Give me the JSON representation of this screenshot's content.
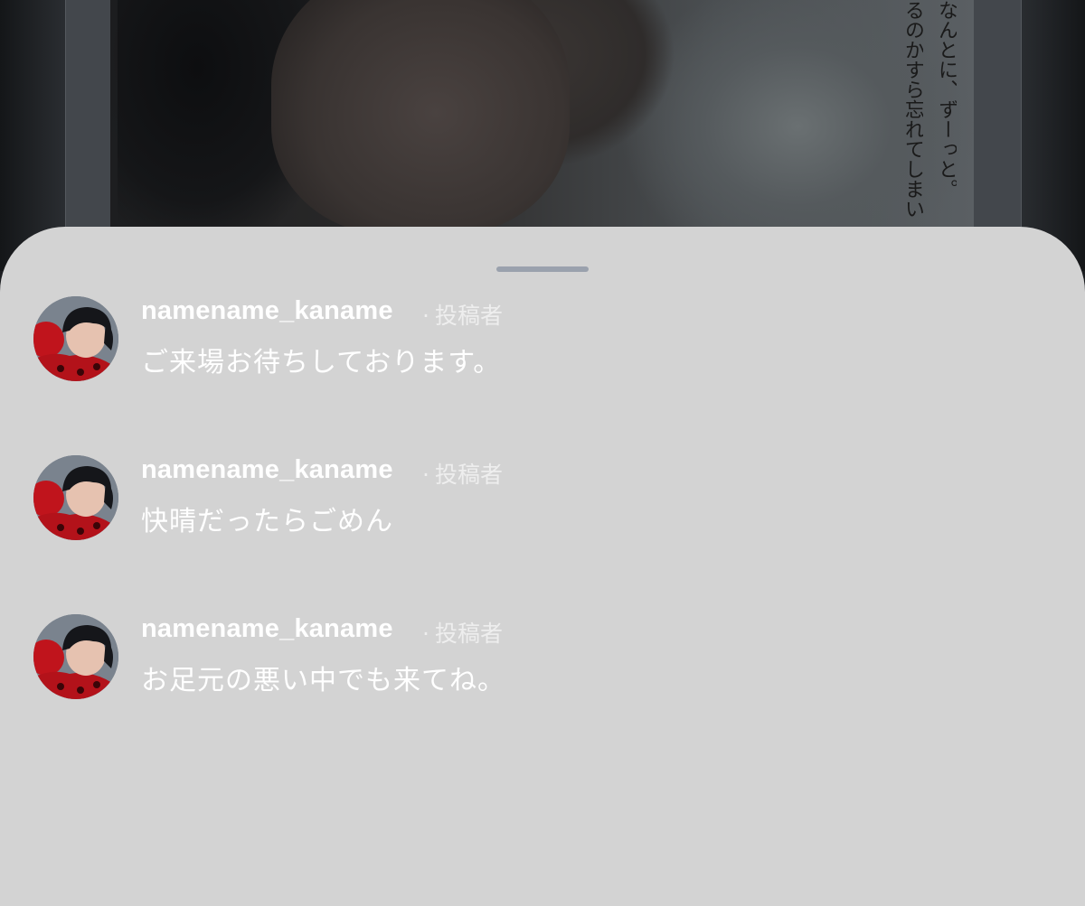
{
  "background_post": {
    "caption_columns": [
      "なんとに、ずーっと。",
      "るのかすら忘れてしまい"
    ]
  },
  "sheet": {
    "comments": [
      {
        "username": "namename_kaname",
        "author_label": "投稿者",
        "text": "ご来場お待ちしております。",
        "avatar_icon": "profile-avatar"
      },
      {
        "username": "namename_kaname",
        "author_label": "投稿者",
        "text": "快晴だったらごめん",
        "avatar_icon": "profile-avatar"
      },
      {
        "username": "namename_kaname",
        "author_label": "投稿者",
        "text": "お足元の悪い中でも来てね。",
        "avatar_icon": "profile-avatar"
      }
    ]
  },
  "colors": {
    "sheet_background": "#d3d3d3",
    "grabber": "#9aa1ad",
    "text": "#ffffff"
  }
}
